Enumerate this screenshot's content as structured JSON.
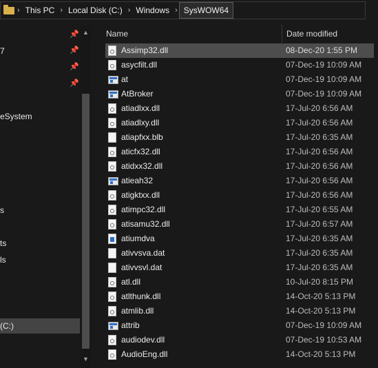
{
  "address_bar": {
    "crumbs": [
      "This PC",
      "Local Disk (C:)",
      "Windows",
      "SysWOW64"
    ],
    "separator": "›"
  },
  "nav": {
    "items": [
      {
        "label": "7",
        "pinned": true
      },
      {
        "label": "eSystem",
        "pinned": false
      },
      {
        "label": "s",
        "pinned": false
      },
      {
        "label": "ts",
        "pinned": false
      },
      {
        "label": "ls",
        "pinned": false
      },
      {
        "label": " (C:)",
        "selected": true
      }
    ]
  },
  "columns": {
    "name": "Name",
    "date": "Date modified"
  },
  "files": [
    {
      "name": "Assimp32.dll",
      "date": "08-Dec-20 1:55 PM",
      "icon": "dll-icon",
      "selected": true
    },
    {
      "name": "asycfilt.dll",
      "date": "07-Dec-19 10:09 AM",
      "icon": "dll-icon"
    },
    {
      "name": "at",
      "date": "07-Dec-19 10:09 AM",
      "icon": "exe-icon"
    },
    {
      "name": "AtBroker",
      "date": "07-Dec-19 10:09 AM",
      "icon": "exe-icon"
    },
    {
      "name": "atiadlxx.dll",
      "date": "17-Jul-20 6:56 AM",
      "icon": "dll-icon"
    },
    {
      "name": "atiadlxy.dll",
      "date": "17-Jul-20 6:56 AM",
      "icon": "dll-icon"
    },
    {
      "name": "atiapfxx.blb",
      "date": "17-Jul-20 6:35 AM",
      "icon": "file-icon"
    },
    {
      "name": "aticfx32.dll",
      "date": "17-Jul-20 6:56 AM",
      "icon": "dll-icon"
    },
    {
      "name": "atidxx32.dll",
      "date": "17-Jul-20 6:56 AM",
      "icon": "dll-icon"
    },
    {
      "name": "atieah32",
      "date": "17-Jul-20 6:56 AM",
      "icon": "exe-icon"
    },
    {
      "name": "atigktxx.dll",
      "date": "17-Jul-20 6:56 AM",
      "icon": "dll-icon"
    },
    {
      "name": "atimpc32.dll",
      "date": "17-Jul-20 6:55 AM",
      "icon": "dll-icon"
    },
    {
      "name": "atisamu32.dll",
      "date": "17-Jul-20 6:57 AM",
      "icon": "dll-icon"
    },
    {
      "name": "atiumdva",
      "date": "17-Jul-20 6:35 AM",
      "icon": "app-icon"
    },
    {
      "name": "ativvsva.dat",
      "date": "17-Jul-20 6:35 AM",
      "icon": "file-icon"
    },
    {
      "name": "ativvsvl.dat",
      "date": "17-Jul-20 6:35 AM",
      "icon": "file-icon"
    },
    {
      "name": "atl.dll",
      "date": "10-Jul-20 8:15 PM",
      "icon": "dll-icon"
    },
    {
      "name": "atlthunk.dll",
      "date": "14-Oct-20 5:13 PM",
      "icon": "dll-icon"
    },
    {
      "name": "atmlib.dll",
      "date": "14-Oct-20 5:13 PM",
      "icon": "dll-icon"
    },
    {
      "name": "attrib",
      "date": "07-Dec-19 10:09 AM",
      "icon": "exe-icon"
    },
    {
      "name": "audiodev.dll",
      "date": "07-Dec-19 10:53 AM",
      "icon": "dll-icon"
    },
    {
      "name": "AudioEng.dll",
      "date": "14-Oct-20 5:13 PM",
      "icon": "dll-icon"
    }
  ]
}
